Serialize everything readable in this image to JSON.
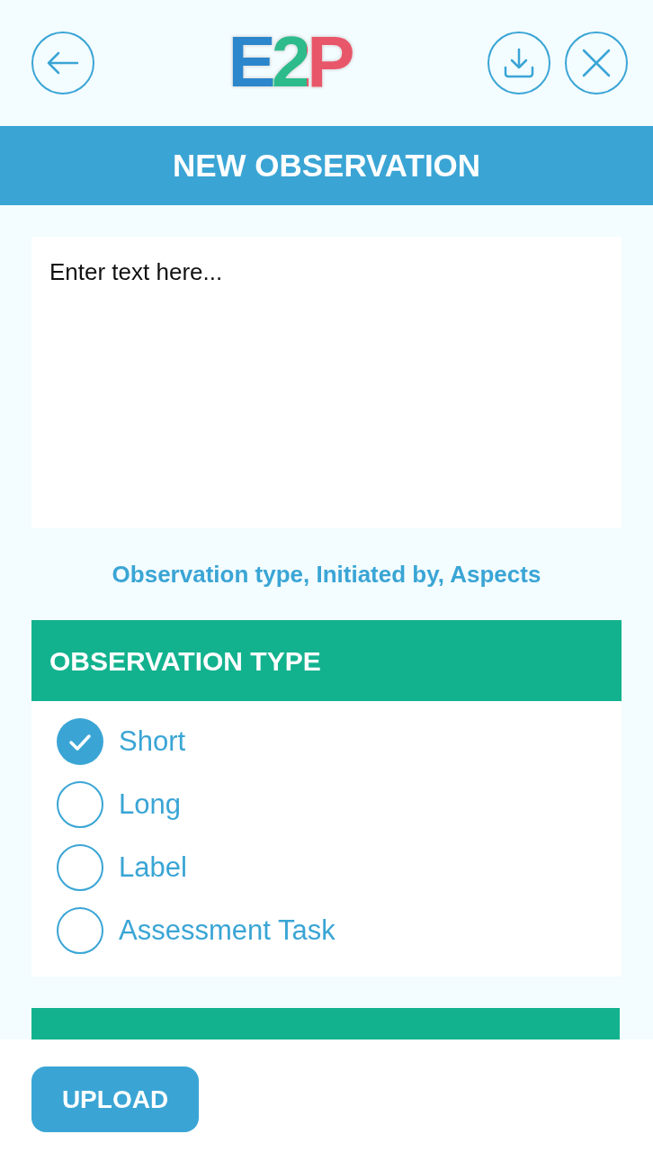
{
  "header": {
    "logo": "E2P"
  },
  "title_bar": {
    "title": "NEW OBSERVATION"
  },
  "note_field": {
    "placeholder": "Enter text here..."
  },
  "details_link": "Observation type, Initiated by, Aspects",
  "sections": [
    {
      "kind": "open",
      "title": "OBSERVATION TYPE",
      "options": [
        {
          "label": "Short",
          "selected": true
        },
        {
          "label": "Long",
          "selected": false
        },
        {
          "label": "Label",
          "selected": false
        },
        {
          "label": "Assessment Task",
          "selected": false
        }
      ]
    },
    {
      "kind": "partial"
    }
  ],
  "footer": {
    "button": "UPLOAD"
  }
}
